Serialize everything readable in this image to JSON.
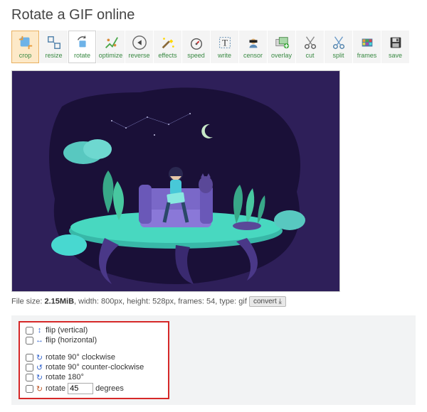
{
  "title": "Rotate a GIF online",
  "toolbar": [
    {
      "key": "crop",
      "label": "crop"
    },
    {
      "key": "resize",
      "label": "resize"
    },
    {
      "key": "rotate",
      "label": "rotate"
    },
    {
      "key": "optimize",
      "label": "optimize"
    },
    {
      "key": "reverse",
      "label": "reverse"
    },
    {
      "key": "effects",
      "label": "effects"
    },
    {
      "key": "speed",
      "label": "speed"
    },
    {
      "key": "write",
      "label": "write"
    },
    {
      "key": "censor",
      "label": "censor"
    },
    {
      "key": "overlay",
      "label": "overlay"
    },
    {
      "key": "cut",
      "label": "cut"
    },
    {
      "key": "split",
      "label": "split"
    },
    {
      "key": "frames",
      "label": "frames"
    },
    {
      "key": "save",
      "label": "save"
    }
  ],
  "fileinfo": {
    "size_label": "File size:",
    "size_value": "2.15MiB",
    "width_label": ", width:",
    "width_value": "800px",
    "height_label": ", height:",
    "height_value": "528px",
    "frames_label": ", frames:",
    "frames_value": "54",
    "type_label": ", type:",
    "type_value": "gif",
    "convert_label": "convert"
  },
  "options": {
    "flip_vertical": "flip (vertical)",
    "flip_horizontal": "flip (horizontal)",
    "rot90cw": "rotate 90° clockwise",
    "rot90ccw": "rotate 90° counter-clockwise",
    "rot180": "rotate 180°",
    "rot_custom": "rotate",
    "rot_value": "45",
    "rot_unit": "degrees"
  }
}
